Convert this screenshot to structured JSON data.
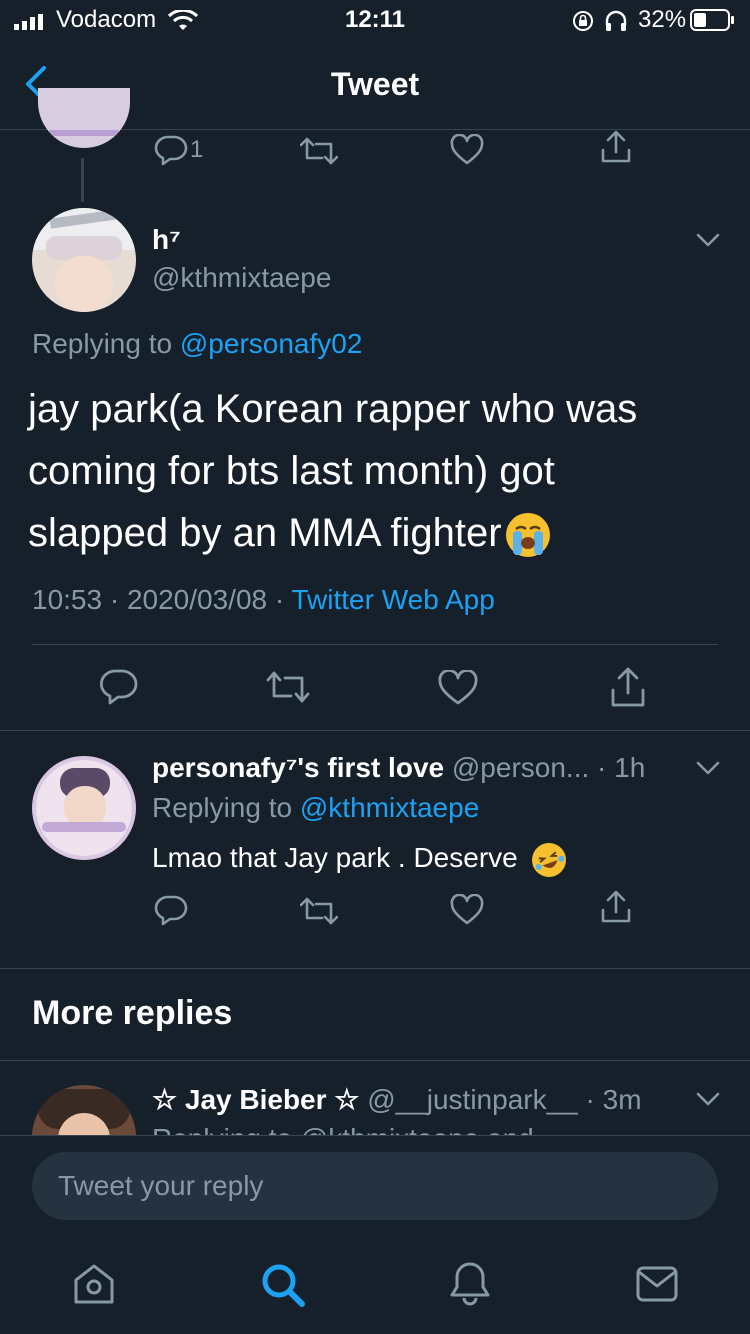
{
  "status_bar": {
    "carrier": "Vodacom",
    "time": "12:11",
    "battery": "32%"
  },
  "header": {
    "title": "Tweet"
  },
  "thread_above": {
    "reply_count": "1"
  },
  "main_tweet": {
    "display_name": "h⁷",
    "handle": "@kthmixtaepe",
    "replying_label": "Replying to",
    "replying_to": "@personafy02",
    "text_line_1": "jay park(a Korean rapper who was",
    "text_line_2": "coming for bts last month) got",
    "text_line_3": "slapped by an MMA fighter",
    "timestamp": "10:53 · 2020/03/08 · ",
    "source": "Twitter Web App"
  },
  "reply_1": {
    "display_name": "personafy⁷'s first love",
    "handle": "@person...",
    "time": "· 1h",
    "replying_label": "Replying to",
    "replying_to": "@kthmixtaepe",
    "text": "Lmao that Jay park . Deserve"
  },
  "more_replies": {
    "heading": "More replies"
  },
  "reply_2": {
    "display_name": "☆ Jay Bieber ☆",
    "handle": "@__justinpark__",
    "time": "· 3m",
    "replying_partial": "Replying to @kthmixtaepe and"
  },
  "compose": {
    "placeholder": "Tweet your reply"
  },
  "tabbar": {
    "icons": [
      "home-icon",
      "search-icon",
      "notifications-icon",
      "messages-icon"
    ]
  },
  "colors": {
    "background": "#15202b",
    "accent": "#1da1f2",
    "secondary_text": "#8899a6",
    "divider": "#38444d"
  }
}
